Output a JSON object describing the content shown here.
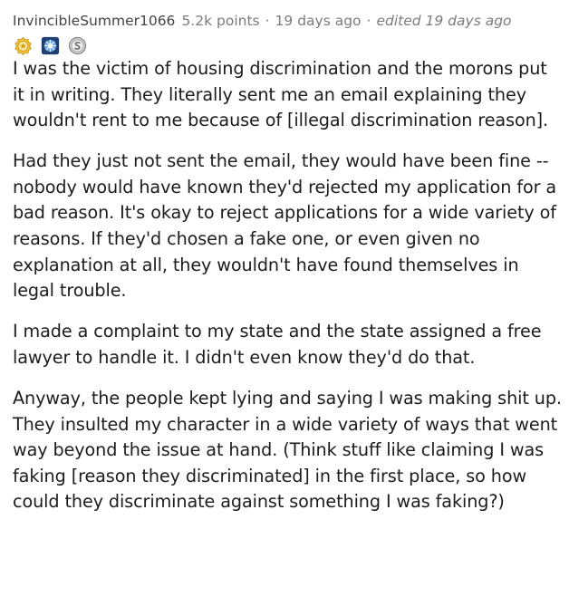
{
  "comment": {
    "username": "InvincibleSummer1066",
    "points": "5.2k points",
    "separator": "·",
    "time": "19 days ago",
    "edited": "edited 19 days ago",
    "awards": [
      {
        "icon": "gold-award-icon",
        "color": "#e8b020"
      },
      {
        "icon": "silver-medal-award-icon",
        "color": "#2e5c9c"
      },
      {
        "icon": "silver-coin-award-icon",
        "color": "#9a9a9a"
      }
    ],
    "paragraphs": [
      "I was the victim of housing discrimination and the morons put it in writing. They literally sent me an email explaining they wouldn't rent to me because of [illegal discrimination reason].",
      "Had they just not sent the email, they would have been fine -- nobody would have known they'd rejected my application for a bad reason. It's okay to reject applications for a wide variety of reasons. If they'd chosen a fake one, or even given no explanation at all, they wouldn't have found themselves in legal trouble.",
      "I made a complaint to my state and the state assigned a free lawyer to handle it. I didn't even know they'd do that.",
      "Anyway, the people kept lying and saying I was making shit up. They insulted my character in a wide variety of ways that went way beyond the issue at hand. (Think stuff like claiming I was faking [reason they discriminated] in the first place, so how could they discriminate against something I was faking?)"
    ]
  }
}
